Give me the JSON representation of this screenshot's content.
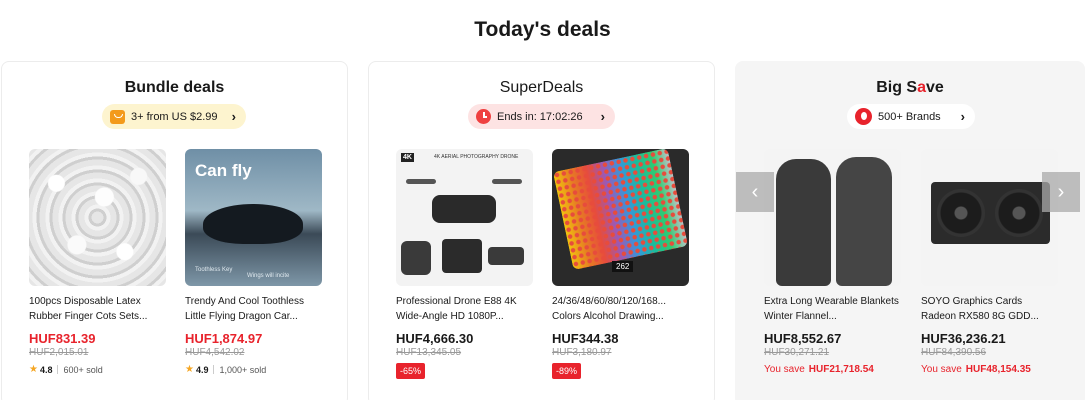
{
  "title": "Today's deals",
  "bundle": {
    "title": "Bundle deals",
    "pill": "3+ from US $2.99",
    "products": [
      {
        "name": "100pcs Disposable Latex Rubber Finger Cots Sets...",
        "price": "HUF831.39",
        "old_price": "HUF2,015.01",
        "rating": "4.8",
        "sold": "600+ sold"
      },
      {
        "name": "Trendy And Cool Toothless Little Flying Dragon Car...",
        "price": "HUF1,874.97",
        "old_price": "HUF4,542.02",
        "rating": "4.9",
        "sold": "1,000+ sold",
        "image_text": "Can fly",
        "image_small_1": "Toothless Key",
        "image_small_2": "Wings will incite"
      }
    ]
  },
  "superdeals": {
    "title": "SuperDeals",
    "pill": "Ends in: 17:02:26",
    "products": [
      {
        "name": "Professional Drone E88 4K Wide-Angle HD 1080P...",
        "price": "HUF4,666.30",
        "old_price": "HUF13,345.05",
        "discount": "-65%",
        "image_tag": "4K",
        "image_text": "4K AERIAL PHOTOGRAPHY DRONE"
      },
      {
        "name": "24/36/48/60/80/120/168... Colors Alcohol Drawing...",
        "price": "HUF344.38",
        "old_price": "HUF3,180.97",
        "discount": "-89%",
        "image_label": "262"
      }
    ]
  },
  "bigsave": {
    "title_pre": "Big S",
    "title_accent": "a",
    "title_post": "ve",
    "pill": "500+ Brands",
    "products": [
      {
        "name": "Extra Long Wearable Blankets Winter Flannel...",
        "price": "HUF8,552.67",
        "old_price": "HUF30,271.21",
        "save_label": "You save",
        "save_amount": "HUF21,718.54"
      },
      {
        "name": "SOYO Graphics Cards Radeon RX580 8G GDD...",
        "price": "HUF36,236.21",
        "old_price": "HUF84,390.56",
        "save_label": "You save",
        "save_amount": "HUF48,154.35"
      }
    ]
  },
  "icons": {
    "chevron": "›",
    "prev": "‹",
    "next": "›",
    "star": "★"
  },
  "colors": {
    "accent_red": "#e8232c",
    "bundle_pill": "#fdf4cf",
    "super_pill": "#fde3e3",
    "star": "#f5a623"
  }
}
